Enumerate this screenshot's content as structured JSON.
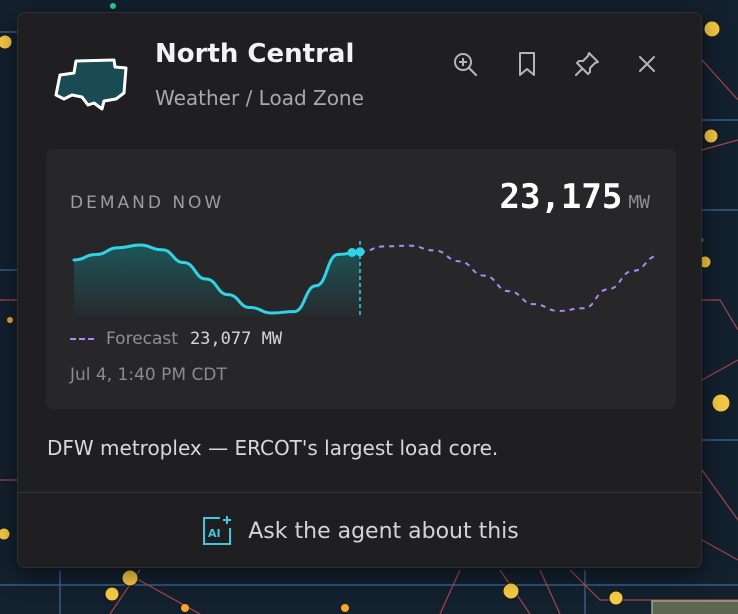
{
  "header": {
    "title": "North Central",
    "subtitle": "Weather / Load Zone",
    "zone_icon": "north-central-zone-shape",
    "actions": [
      {
        "name": "zoom-in",
        "icon": "magnifier-plus-icon"
      },
      {
        "name": "bookmark",
        "icon": "bookmark-icon"
      },
      {
        "name": "pin",
        "icon": "pin-icon"
      },
      {
        "name": "close",
        "icon": "close-icon"
      }
    ]
  },
  "demand": {
    "label": "DEMAND NOW",
    "value": "23,175",
    "unit": "MW"
  },
  "forecast": {
    "label": "Forecast",
    "value": "23,077 MW"
  },
  "timestamp": "Jul 4, 1:40 PM CDT",
  "description": "DFW metroplex — ERCOT's largest load core.",
  "agent": {
    "label": "Ask the agent about this",
    "icon": "ai-sparkle-icon"
  },
  "colors": {
    "actual_line": "#2fd3e6",
    "forecast_line": "#a78bfa",
    "card_bg": "#1f1f22",
    "map_bg": "#13202e"
  },
  "chart_data": {
    "type": "line",
    "series": [
      {
        "values": [
          0.78,
          0.86,
          0.96,
          1.0,
          0.93,
          0.74,
          0.5,
          0.27,
          0.08,
          0.0,
          0.02,
          0.4,
          0.86,
          0.9
        ]
      },
      {
        "values": [
          0.9,
          0.98,
          0.99,
          0.92,
          0.76,
          0.55,
          0.32,
          0.13,
          0.03,
          0.07,
          0.35,
          0.62,
          0.84
        ]
      }
    ]
  }
}
